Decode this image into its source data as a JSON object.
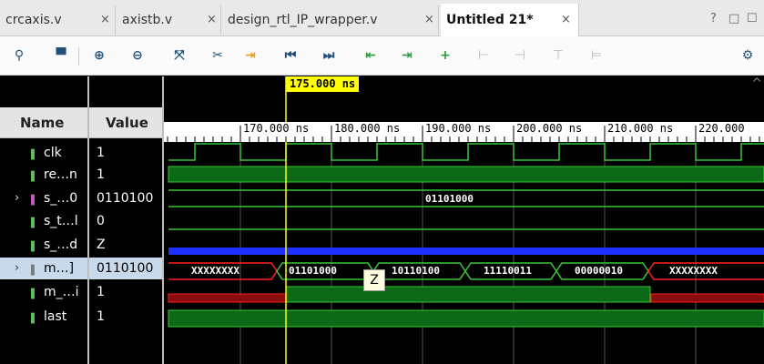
{
  "tabs": [
    {
      "label": "crcaxis.v",
      "close": "×"
    },
    {
      "label": "axistb.v",
      "close": "×"
    },
    {
      "label": "design_rtl_IP_wrapper.v",
      "close": "×"
    },
    {
      "label": "Untitled 21*",
      "close": "×"
    }
  ],
  "window_buttons": [
    "?",
    "□",
    "☐"
  ],
  "toolbar": {
    "icons": [
      "search-icon",
      "save-icon",
      "zoom-in-icon",
      "zoom-out-icon",
      "zoom-fit-icon",
      "cut-cursor-icon",
      "go-to-time-zero-icon",
      "go-to-start-icon",
      "go-to-end-icon",
      "previous-transition-icon",
      "next-transition-icon",
      "add-marker-icon",
      "previous-marker-icon",
      "next-marker-icon",
      "swap-cursors-icon",
      "fix-marker-icon",
      "settings-icon"
    ]
  },
  "panel": {
    "name_header": "Name",
    "value_header": "Value",
    "signals": [
      {
        "name": "clk",
        "value": "1"
      },
      {
        "name": "re…n",
        "value": "1"
      },
      {
        "name": "s_…0",
        "value": "0110100"
      },
      {
        "name": "s_t…l",
        "value": "0"
      },
      {
        "name": "s_…d",
        "value": "Z"
      },
      {
        "name": "m…]",
        "value": "0110100"
      },
      {
        "name": "m_…i",
        "value": "1"
      },
      {
        "name": "last",
        "value": "1"
      }
    ]
  },
  "wave": {
    "cursor_label": "175.000 ns",
    "ticks": [
      "170.000 ns",
      "180.000 ns",
      "190.000 ns",
      "200.000 ns",
      "210.000 ns",
      "220.000"
    ],
    "s_bus_value": "01101000",
    "m_bus_values": [
      "XXXXXXXX",
      "01101000",
      "10110100",
      "11110011",
      "00000010",
      "XXXXXXXX"
    ],
    "tooltip": "Z"
  },
  "colors": {
    "signal_green": "#39c639",
    "wave_fill": "#0c6a16",
    "cursor": "#ffff00",
    "x_red": "#ff2020",
    "z_blue": "#2030ff"
  }
}
